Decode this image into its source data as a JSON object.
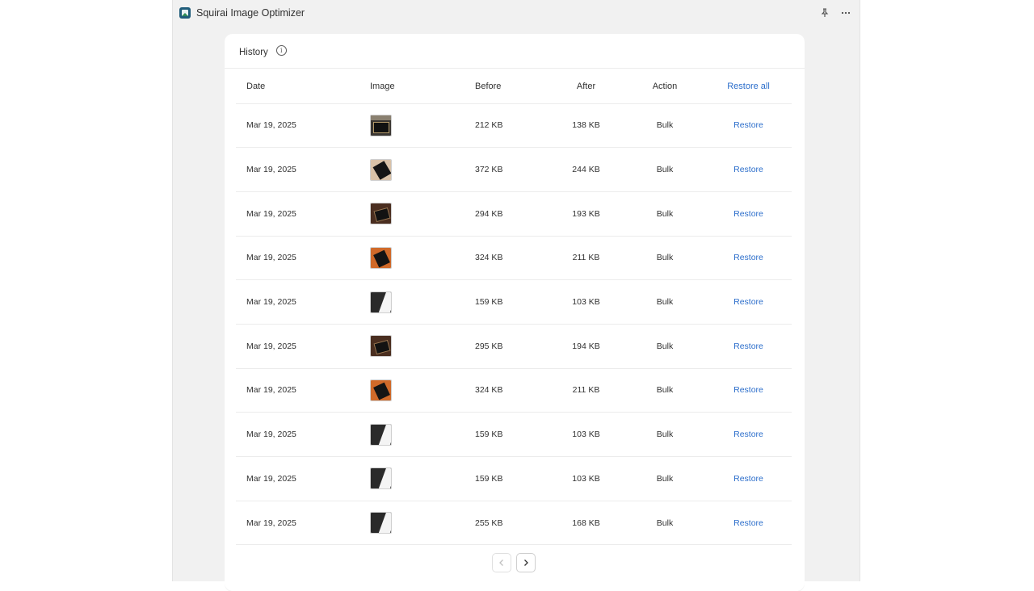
{
  "app": {
    "title": "Squirai Image Optimizer"
  },
  "card": {
    "title": "History"
  },
  "table": {
    "headers": {
      "date": "Date",
      "image": "Image",
      "before": "Before",
      "after": "After",
      "action": "Action",
      "restore_all": "Restore all"
    },
    "rows": [
      {
        "date": "Mar 19, 2025",
        "before": "212 KB",
        "after": "138 KB",
        "action": "Bulk",
        "restore": "Restore",
        "thumb": "dark-sign"
      },
      {
        "date": "Mar 19, 2025",
        "before": "372 KB",
        "after": "244 KB",
        "action": "Bulk",
        "restore": "Restore",
        "thumb": "tilted-sign"
      },
      {
        "date": "Mar 19, 2025",
        "before": "294 KB",
        "after": "193 KB",
        "action": "Bulk",
        "restore": "Restore",
        "thumb": "brown-sign"
      },
      {
        "date": "Mar 19, 2025",
        "before": "324 KB",
        "after": "211 KB",
        "action": "Bulk",
        "restore": "Restore",
        "thumb": "orange-sign"
      },
      {
        "date": "Mar 19, 2025",
        "before": "159 KB",
        "after": "103 KB",
        "action": "Bulk",
        "restore": "Restore",
        "thumb": "black-white-sign"
      },
      {
        "date": "Mar 19, 2025",
        "before": "295 KB",
        "after": "194 KB",
        "action": "Bulk",
        "restore": "Restore",
        "thumb": "brown-sign"
      },
      {
        "date": "Mar 19, 2025",
        "before": "324 KB",
        "after": "211 KB",
        "action": "Bulk",
        "restore": "Restore",
        "thumb": "orange-sign"
      },
      {
        "date": "Mar 19, 2025",
        "before": "159 KB",
        "after": "103 KB",
        "action": "Bulk",
        "restore": "Restore",
        "thumb": "black-white-sign"
      },
      {
        "date": "Mar 19, 2025",
        "before": "159 KB",
        "after": "103 KB",
        "action": "Bulk",
        "restore": "Restore",
        "thumb": "black-white-sign"
      },
      {
        "date": "Mar 19, 2025",
        "before": "255 KB",
        "after": "168 KB",
        "action": "Bulk",
        "restore": "Restore",
        "thumb": "black-white-sign"
      }
    ]
  },
  "pagination": {
    "prev_icon": "chevron-left-icon",
    "next_icon": "chevron-right-icon",
    "prev_disabled": true
  },
  "colors": {
    "link": "#2c6ecb",
    "frame_bg": "#f1f1f1",
    "card_bg": "#ffffff"
  }
}
